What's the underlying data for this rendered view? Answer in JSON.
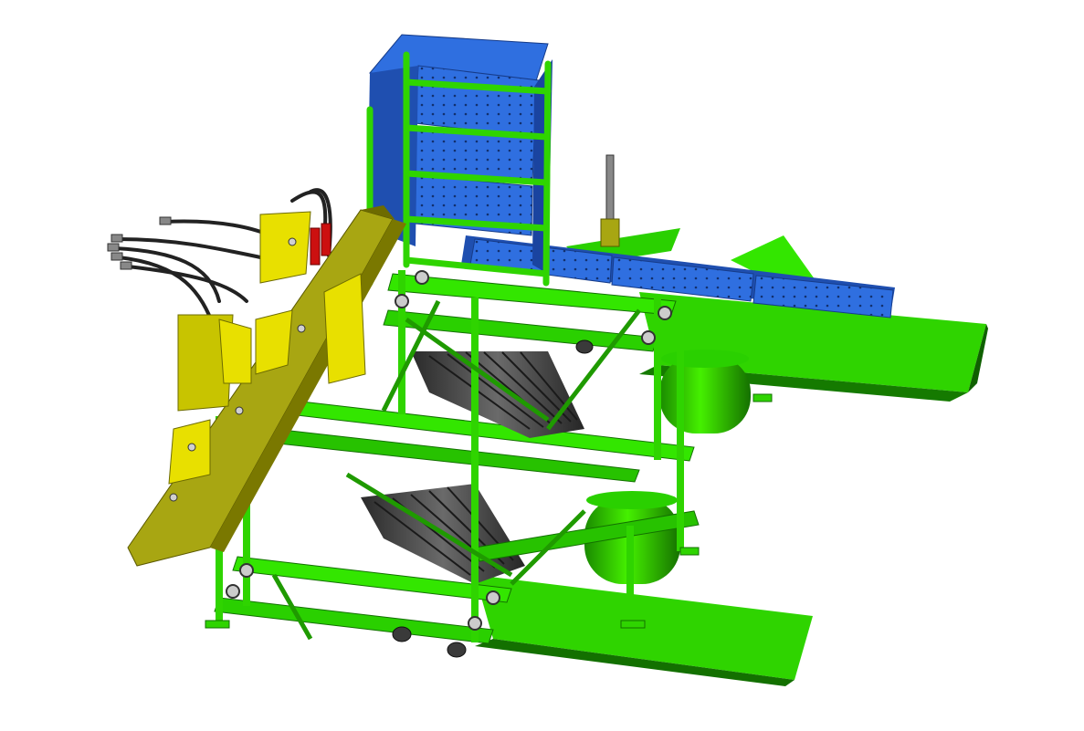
{
  "scene": {
    "kind": "3D CAD render of a green, blue and yellow multi-row agricultural planting machine on a white background",
    "colors": {
      "background": "#ffffff",
      "frame_green": "#33e600",
      "frame_green_dark": "#1f9a00",
      "frame_green_shadow": "#137000",
      "bin_blue": "#2f6fe0",
      "bin_blue_dark": "#1f4fb0",
      "hitch_yellow": "#e8e000",
      "hitch_olive": "#9c9a10",
      "roller_gray": "#4a4a4a",
      "hose_black": "#222222",
      "cylinder_red": "#cc1010"
    }
  }
}
